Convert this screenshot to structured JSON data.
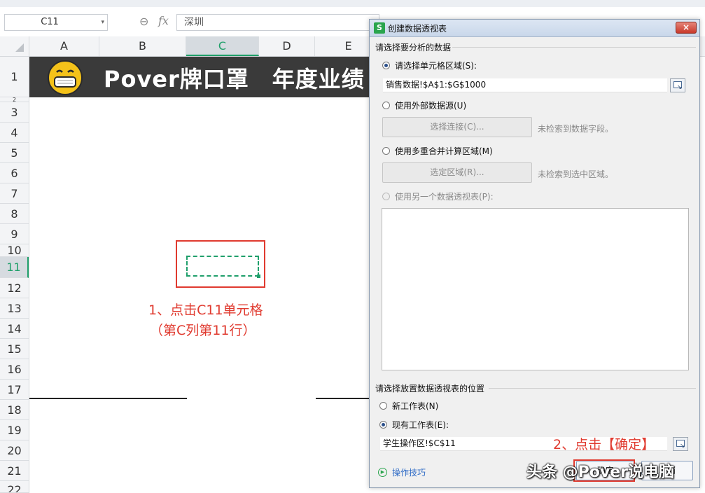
{
  "toolbar": {
    "namebox": "C11",
    "formula_value": "深圳"
  },
  "columns": [
    {
      "label": "A",
      "selected": false
    },
    {
      "label": "B",
      "selected": false
    },
    {
      "label": "C",
      "selected": true
    },
    {
      "label": "D",
      "selected": false
    },
    {
      "label": "E",
      "selected": false
    }
  ],
  "rows": [
    "1",
    "2",
    "3",
    "4",
    "5",
    "6",
    "7",
    "8",
    "9",
    "10",
    "11",
    "12",
    "13",
    "14",
    "15",
    "16",
    "17",
    "18",
    "19",
    "20",
    "21",
    "22"
  ],
  "selected_row": "11",
  "sheet": {
    "banner_title": "Pover牌口罩　年度业绩",
    "accent_color": "#20a06a",
    "banner_color": "#3a3a3a"
  },
  "annotations": {
    "note1_line1": "1、点击C11单元格",
    "note1_line2": "（第C列第11行）",
    "note2": "2、点击【确定】",
    "color": "#e03a2f"
  },
  "dialog": {
    "title": "创建数据透视表",
    "close_label": "×",
    "section1": "请选择要分析的数据",
    "opt_cell_range": "请选择单元格区域(S):",
    "range_value": "销售数据!$A$1:$G$1000",
    "opt_external": "使用外部数据源(U)",
    "btn_choose_conn": "选择连接(C)...",
    "no_fields_msg": "未检索到数据字段。",
    "opt_multi": "使用多重合并计算区域(M)",
    "btn_choose_range": "选定区域(R)...",
    "no_region_msg": "未检索到选中区域。",
    "opt_other_pivot": "使用另一个数据透视表(P):",
    "section2": "请选择放置数据透视表的位置",
    "opt_new_sheet": "新工作表(N)",
    "opt_existing_sheet": "现有工作表(E):",
    "location_value": "学生操作区!$C$11",
    "tips": "操作技巧",
    "ok": "确定",
    "cancel": "取消"
  },
  "watermark": "头条 @Pover说电脑"
}
